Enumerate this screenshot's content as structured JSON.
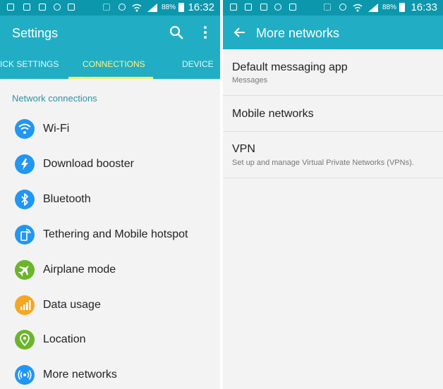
{
  "colors": {
    "statusbar": "#0c97ad",
    "appbar": "#21aec5",
    "active_tab": "#fcf38b",
    "section_header": "#2b93a7"
  },
  "left": {
    "status": {
      "battery": "88%",
      "time": "16:32"
    },
    "appbar": {
      "title": "Settings",
      "search_icon": "search-icon",
      "menu_icon": "more-vert-icon"
    },
    "tabs": [
      {
        "label": "ICK SETTINGS"
      },
      {
        "label": "CONNECTIONS"
      },
      {
        "label": "DEVICE"
      }
    ],
    "section_title": "Network connections",
    "items": [
      {
        "label": "Wi-Fi",
        "icon": "wifi-icon",
        "color": "#2196f3"
      },
      {
        "label": "Download booster",
        "icon": "download-booster-icon",
        "color": "#2196f3"
      },
      {
        "label": "Bluetooth",
        "icon": "bluetooth-icon",
        "color": "#2196f3"
      },
      {
        "label": "Tethering and Mobile hotspot",
        "icon": "hotspot-icon",
        "color": "#2196f3"
      },
      {
        "label": "Airplane mode",
        "icon": "airplane-icon",
        "color": "#6bb52b"
      },
      {
        "label": "Data usage",
        "icon": "data-usage-icon",
        "color": "#f5a623"
      },
      {
        "label": "Location",
        "icon": "location-icon",
        "color": "#6bb52b"
      },
      {
        "label": "More networks",
        "icon": "more-networks-icon",
        "color": "#2196f3"
      }
    ]
  },
  "right": {
    "status": {
      "battery": "88%",
      "time": "16:33"
    },
    "appbar": {
      "title": "More networks",
      "back_icon": "back-arrow-icon"
    },
    "items": [
      {
        "title": "Default messaging app",
        "subtitle": "Messages"
      },
      {
        "title": "Mobile networks",
        "subtitle": ""
      },
      {
        "title": "VPN",
        "subtitle": "Set up and manage Virtual Private Networks (VPNs)."
      }
    ]
  }
}
